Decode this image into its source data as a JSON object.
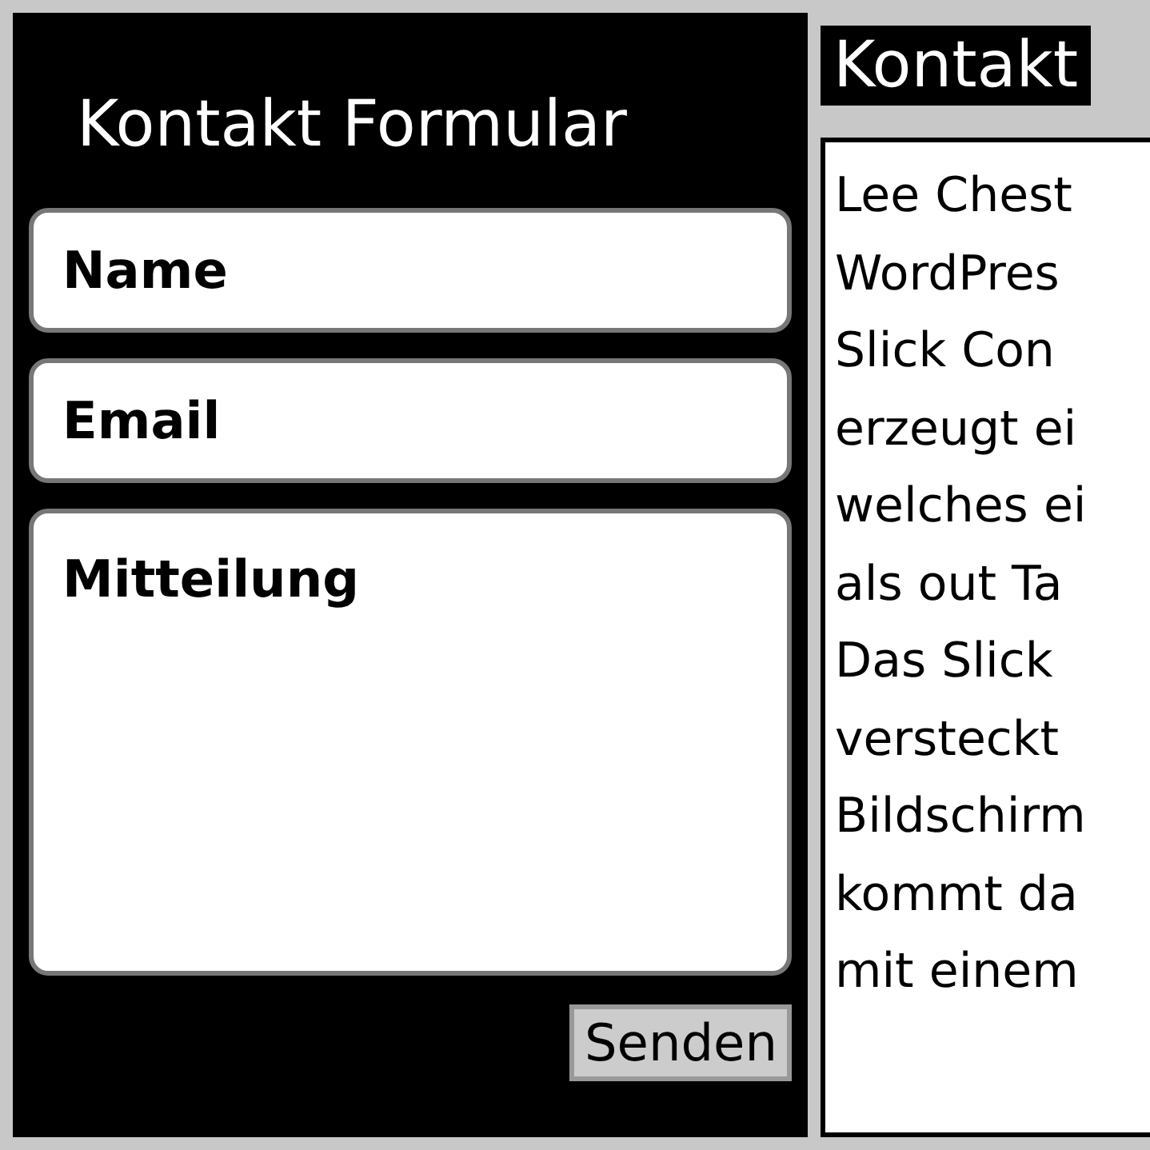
{
  "form": {
    "title": "Kontakt Formular",
    "fields": [
      {
        "kind": "input",
        "placeholder": "Name"
      },
      {
        "kind": "input",
        "placeholder": "Email"
      },
      {
        "kind": "textarea",
        "placeholder": "Mitteilung"
      }
    ],
    "submit": "Senden"
  },
  "slide_panel": {
    "tab": "Kontakt",
    "lines": [
      "Lee Chest",
      "WordPres",
      "Slick Con",
      "erzeugt ei",
      "welches ei",
      "als out Ta",
      "Das Slick",
      "versteckt",
      "Bildschirm",
      "kommt da",
      "mit einem"
    ]
  }
}
